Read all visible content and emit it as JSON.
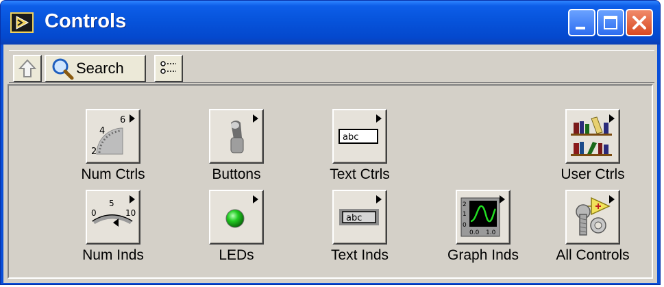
{
  "window": {
    "title": "Controls",
    "buttons": {
      "minimize": "minimize-button",
      "maximize": "maximize-button",
      "close": "close-button"
    }
  },
  "toolbar": {
    "up_icon": "up-arrow-icon",
    "search_label": "Search",
    "search_icon": "magnifier-icon",
    "options_icon": "view-options-icon"
  },
  "palette": {
    "items": [
      {
        "label": "Num Ctrls",
        "icon": "knob-icon"
      },
      {
        "label": "Buttons",
        "icon": "toggle-switch-icon"
      },
      {
        "label": "Text Ctrls",
        "icon": "text-control-icon"
      },
      {
        "label": "User Ctrls",
        "icon": "bookshelf-icon"
      },
      {
        "label": "Num Inds",
        "icon": "meter-icon"
      },
      {
        "label": "LEDs",
        "icon": "led-icon"
      },
      {
        "label": "Text Inds",
        "icon": "text-indicator-icon"
      },
      {
        "label": "Graph Inds",
        "icon": "graph-icon"
      },
      {
        "label": "All Controls",
        "icon": "all-controls-icon"
      }
    ],
    "text_ctrl_sample": "abc",
    "text_ind_sample": "abc",
    "knob_ticks": [
      "2",
      "4",
      "6"
    ],
    "meter_ticks": [
      "0",
      "5",
      "10"
    ],
    "graph_axis": [
      "2",
      "1",
      "0",
      "0.0",
      "1.0"
    ]
  },
  "colors": {
    "titlebar": "#0652d9",
    "client": "#d4d0c8",
    "led": "#22cc22",
    "close_button": "#d84a22"
  }
}
